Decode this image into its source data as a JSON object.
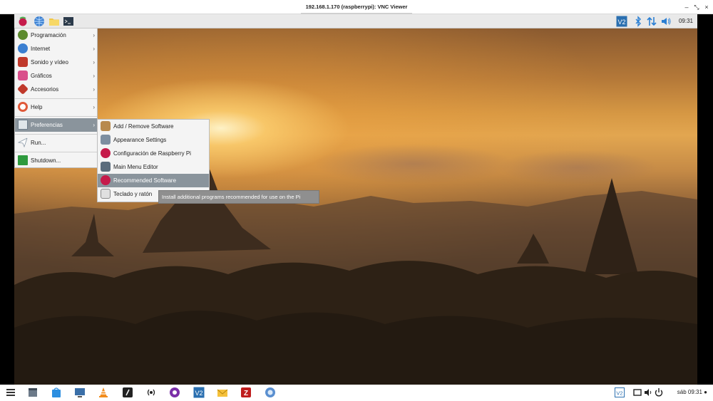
{
  "window": {
    "title": "192.168.1.170 (raspberrypi): VNC Viewer",
    "minimize_label": "–",
    "restore_label": "⤡",
    "close_label": "×"
  },
  "remote_panel": {
    "clock": "09:31",
    "launchers": [
      "raspberry-menu-icon",
      "web-browser-icon",
      "file-manager-icon",
      "terminal-icon"
    ],
    "tray": [
      "vnc-icon",
      "bluetooth-icon",
      "network-icon",
      "volume-icon"
    ]
  },
  "main_menu": {
    "items": [
      {
        "label": "Programación",
        "arrow": "›",
        "icon": "programming-icon",
        "color": "#5c8a2e"
      },
      {
        "label": "Internet",
        "arrow": "›",
        "icon": "internet-icon",
        "color": "#3b7fd1"
      },
      {
        "label": "Sonido y vídeo",
        "arrow": "›",
        "icon": "sound-video-icon",
        "color": "#c0392b"
      },
      {
        "label": "Gráficos",
        "arrow": "›",
        "icon": "graphics-icon",
        "color": "#d94f8b"
      },
      {
        "label": "Accesorios",
        "arrow": "›",
        "icon": "accessories-icon",
        "color": "#c0392b"
      },
      {
        "label": "Help",
        "arrow": "›",
        "icon": "help-icon",
        "color": "#e05a3a"
      },
      {
        "label": "Preferencias",
        "arrow": "›",
        "icon": "preferences-icon",
        "color": "#6d7e8c"
      },
      {
        "label": "Run...",
        "arrow": "",
        "icon": "run-icon",
        "color": "#9aa7b3"
      },
      {
        "label": "Shutdown...",
        "arrow": "",
        "icon": "shutdown-icon",
        "color": "#2e9a3e"
      }
    ]
  },
  "preferences_submenu": {
    "items": [
      {
        "label": "Add / Remove Software",
        "icon": "package-icon",
        "color": "#b88a4e"
      },
      {
        "label": "Appearance Settings",
        "icon": "appearance-icon",
        "color": "#7d8ea0"
      },
      {
        "label": "Configuración de Raspberry Pi",
        "icon": "raspberry-config-icon",
        "color": "#c51a4a"
      },
      {
        "label": "Main Menu Editor",
        "icon": "menu-editor-icon",
        "color": "#5a6c7c"
      },
      {
        "label": "Recommended Software",
        "icon": "recommended-software-icon",
        "color": "#c51a4a"
      },
      {
        "label": "Teclado y ratón",
        "icon": "keyboard-mouse-icon",
        "color": "#8a8a8a"
      }
    ]
  },
  "tooltip": "Install additional programs recommended for use on the Pi",
  "taskbar": {
    "apps": [
      "launcher-icon",
      "files-icon",
      "store-icon",
      "remote-desktop-icon",
      "vlc-icon",
      "terminal-app-icon",
      "broadcast-icon",
      "media-player-icon",
      "vnc-viewer-icon",
      "mail-icon",
      "filezilla-icon",
      "browser-icon"
    ],
    "clock": "sáb 09:31 ●"
  },
  "colors": {
    "selected_item": "#8a949c",
    "menu_background": "#f4f4f4",
    "vnc_blue": "#2a6fb0",
    "raspberry_red": "#c51a4a"
  }
}
